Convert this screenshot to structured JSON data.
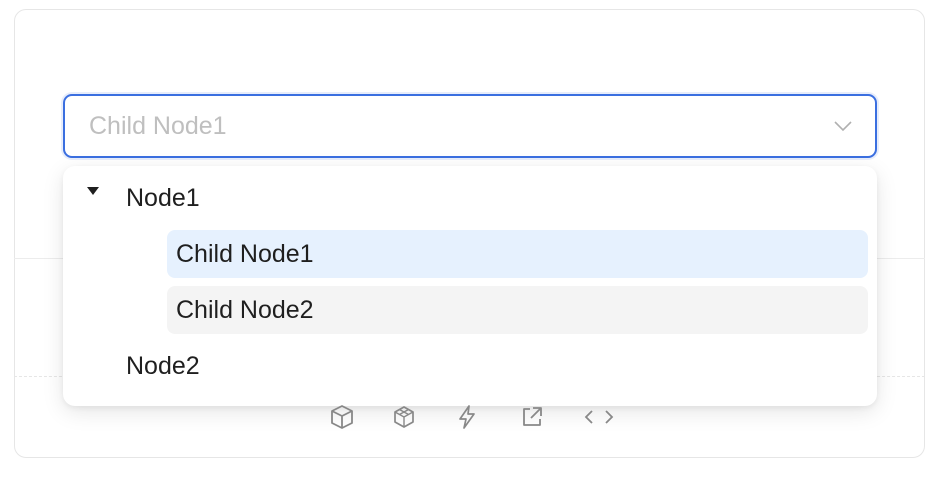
{
  "select": {
    "value": "Child Node1",
    "icon": "chevron-down-icon"
  },
  "tree": {
    "node1": {
      "label": "Node1",
      "expanded": true
    },
    "child1": {
      "label": "Child Node1",
      "selected": true
    },
    "child2": {
      "label": "Child Node2",
      "hovered": true
    },
    "node2": {
      "label": "Node2"
    }
  },
  "toolbar": {
    "icons": [
      "box-icon",
      "codesandbox-icon",
      "thunderbolt-icon",
      "external-link-icon",
      "code-icon"
    ]
  },
  "colors": {
    "accent": "#3b6fe0",
    "selected_bg": "#e6f1fe",
    "hover_bg": "#f4f4f4",
    "placeholder": "#bfbfbf"
  }
}
